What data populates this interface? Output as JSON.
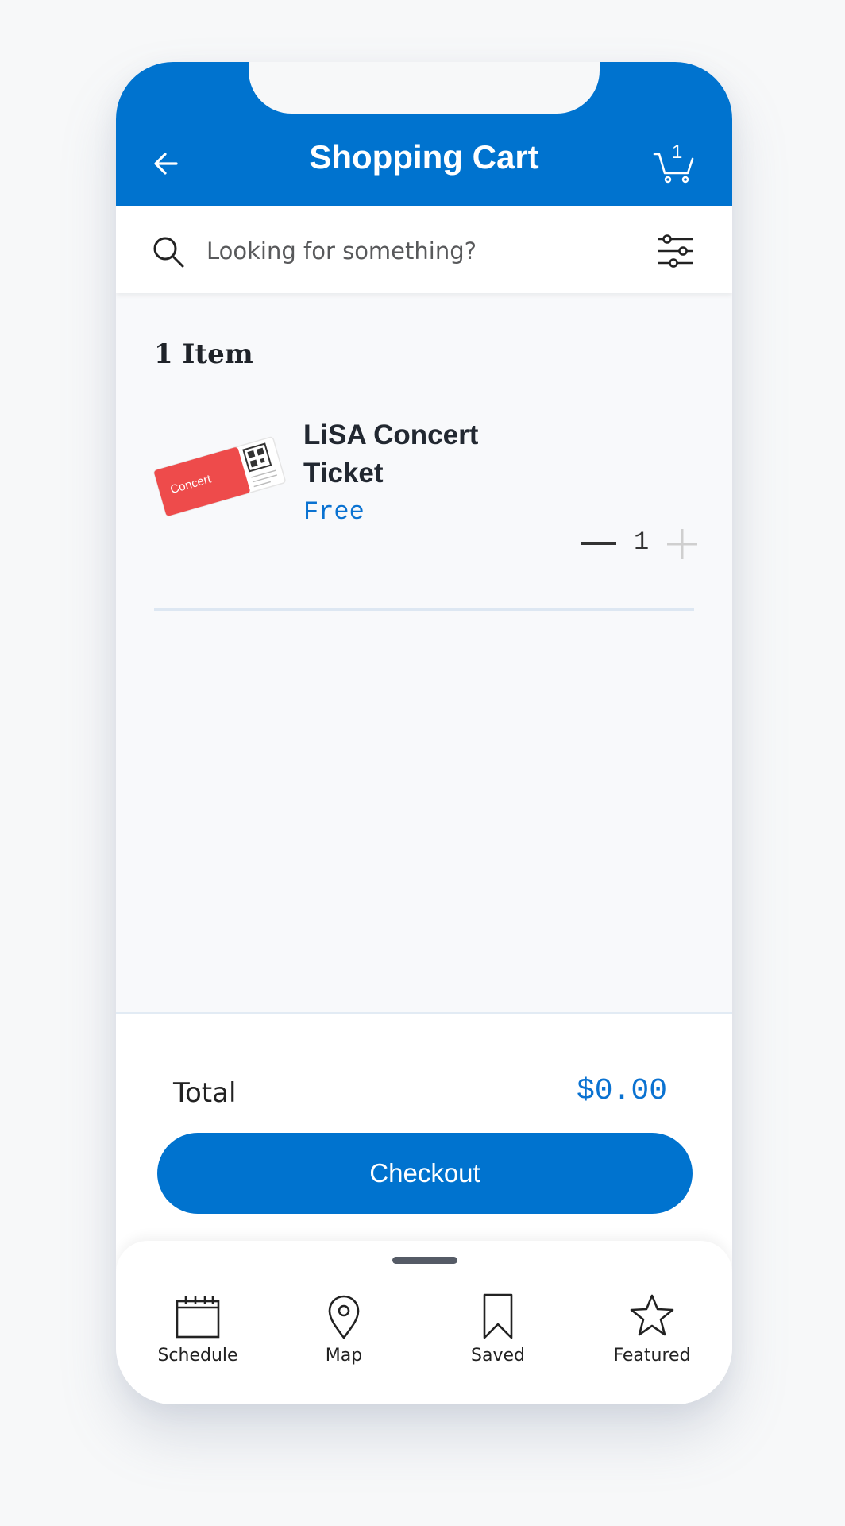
{
  "header": {
    "title": "Shopping Cart",
    "back_icon": "arrow-left-icon",
    "cart_icon": "cart-icon",
    "cart_count": "1",
    "color": "#0073cf"
  },
  "search": {
    "placeholder": "Looking for something?",
    "search_icon": "search-icon",
    "filter_icon": "filter-sliders-icon"
  },
  "cart": {
    "item_count_label": "1 Item",
    "items": [
      {
        "name": "LiSA Concert Ticket",
        "price": "Free",
        "quantity": "1",
        "ticket_text": "Concert"
      }
    ]
  },
  "summary": {
    "total_label": "Total",
    "total_value": "$0.00",
    "checkout_label": "Checkout"
  },
  "nav": {
    "items": [
      {
        "label": "Schedule",
        "icon": "calendar-icon"
      },
      {
        "label": "Map",
        "icon": "map-pin-icon"
      },
      {
        "label": "Saved",
        "icon": "bookmark-icon"
      },
      {
        "label": "Featured",
        "icon": "star-icon"
      }
    ]
  },
  "colors": {
    "accent": "#0073cf",
    "price": "#0a72d1",
    "ticket": "#ee4b4b"
  }
}
